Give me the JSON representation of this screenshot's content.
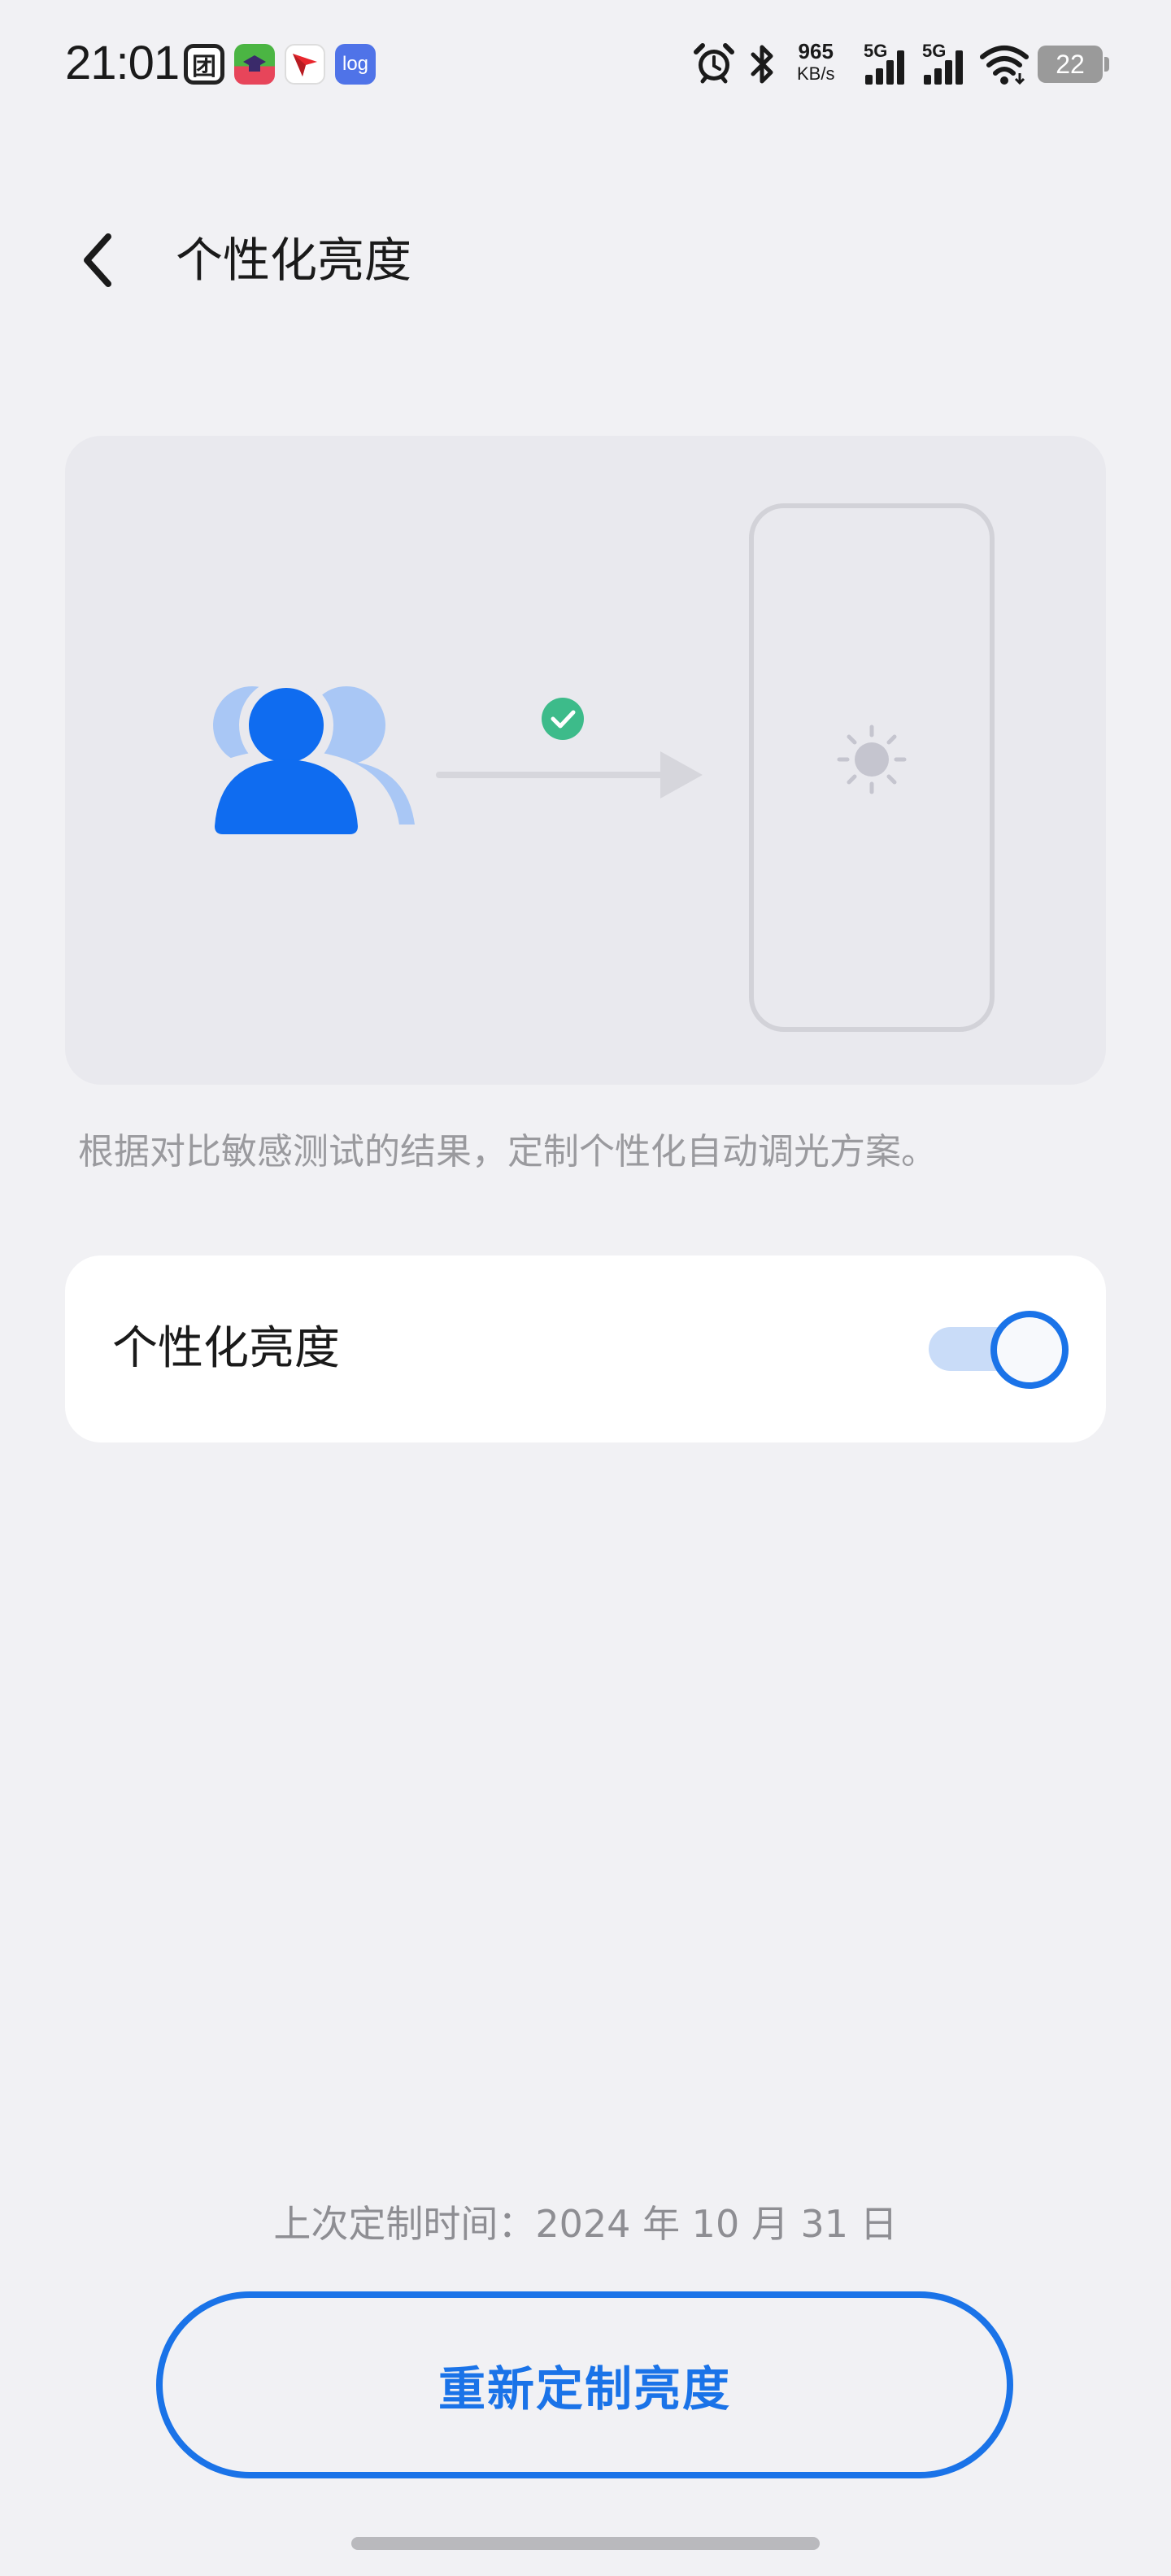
{
  "status_bar": {
    "time": "21:01",
    "apps": [
      "meituan-icon",
      "game-app-icon",
      "arrow-app-icon",
      "log-app-icon"
    ],
    "log_label": "log",
    "meituan_glyph": "团",
    "net_speed_value": "965",
    "net_speed_unit": "KB/s",
    "signal_1_label": "5G",
    "signal_2_label": "5G",
    "battery_level": "22"
  },
  "header": {
    "title": "个性化亮度"
  },
  "illustration": {
    "icons": [
      "users-icon",
      "check-circle-icon",
      "arrow-right-icon",
      "phone-outline-icon",
      "sun-icon"
    ]
  },
  "description": "根据对比敏感测试的结果，定制个性化自动调光方案。",
  "toggle_card": {
    "label": "个性化亮度",
    "enabled": true
  },
  "footer": {
    "last_custom_time": "上次定制时间：2024 年 10 月 31 日",
    "redo_button_label": "重新定制亮度"
  },
  "colors": {
    "accent": "#1a73e8",
    "background": "#f1f1f4",
    "check_green": "#3dbb8a"
  }
}
